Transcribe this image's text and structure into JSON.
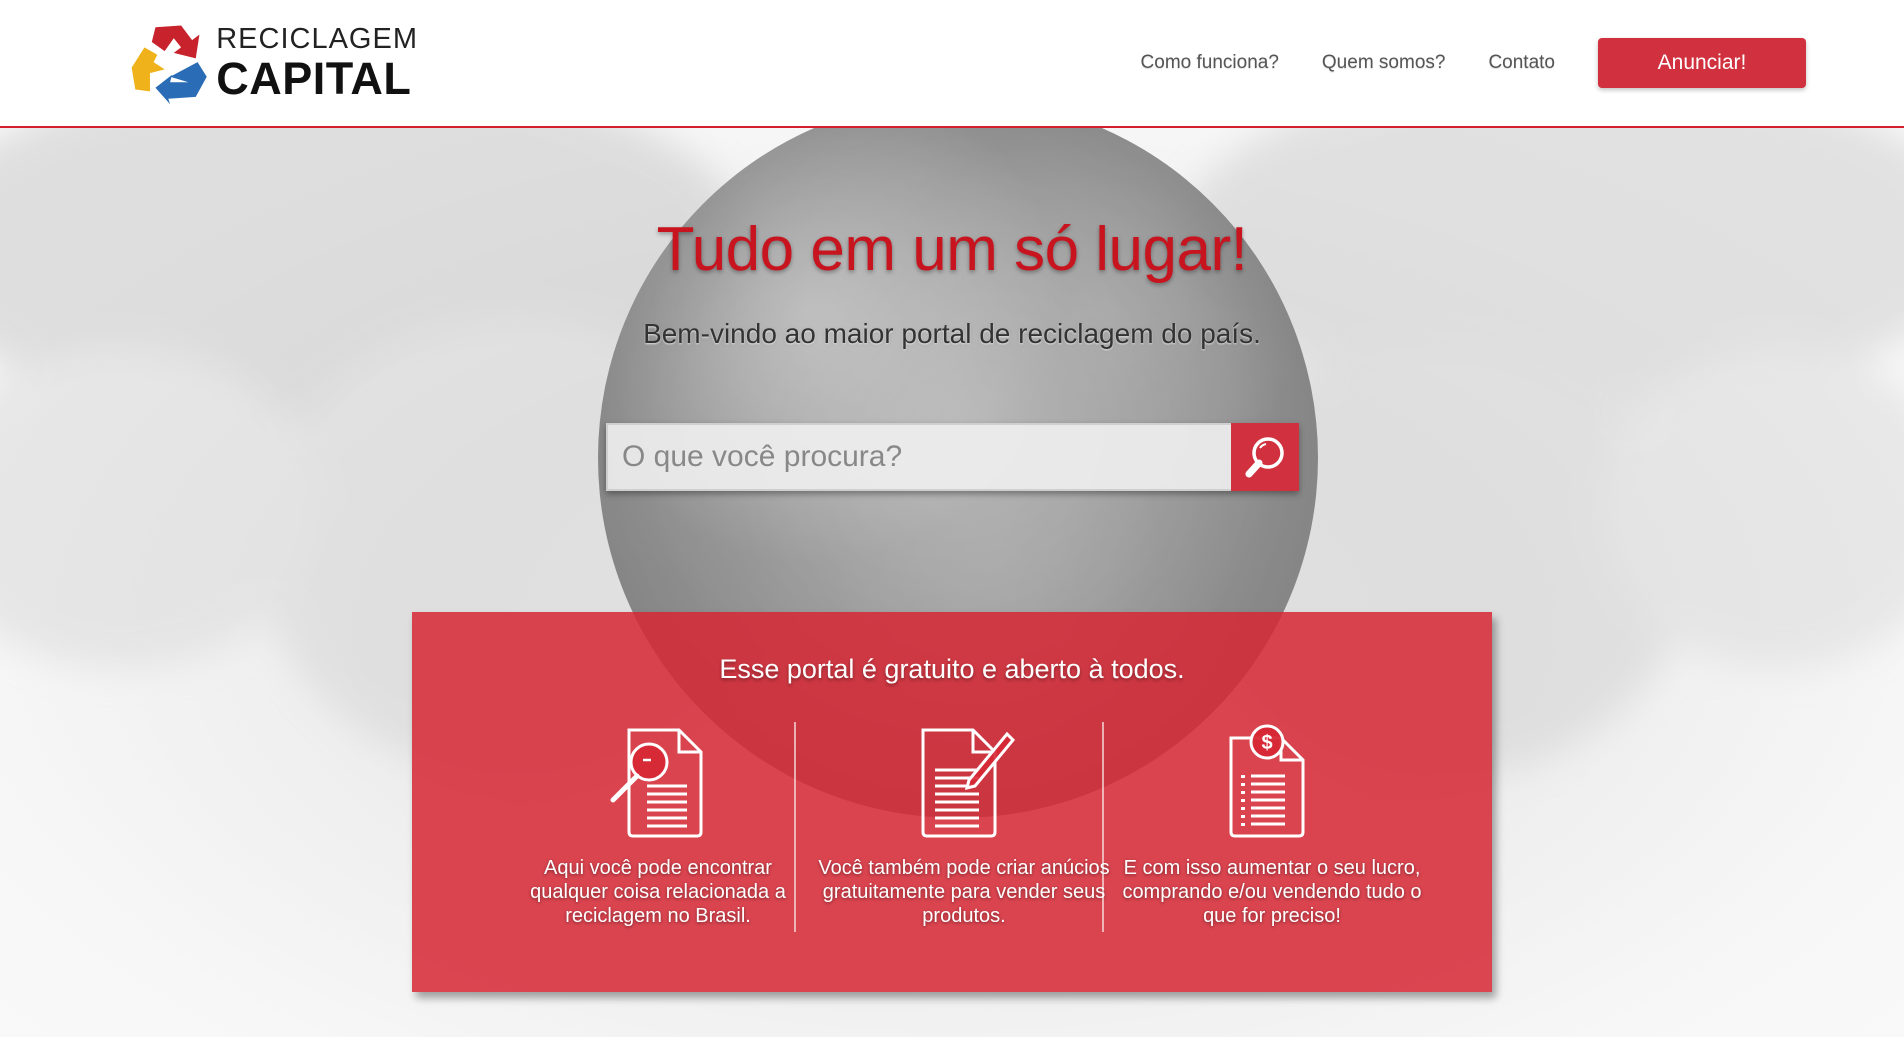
{
  "logo": {
    "line1": "RECICLAGEM",
    "line2": "CAPITAL"
  },
  "nav": {
    "items": [
      "Como funciona?",
      "Quem somos?",
      "Contato"
    ],
    "cta": "Anunciar!"
  },
  "hero": {
    "title": "Tudo em um só lugar!",
    "subtitle": "Bem-vindo ao maior portal de reciclagem do país.",
    "search_placeholder": "O que você procura?"
  },
  "info": {
    "title": "Esse portal é gratuito e aberto à todos.",
    "columns": [
      {
        "icon": "search-document-icon",
        "text": "Aqui você pode encontrar qualquer coisa relacionada a reciclagem no Brasil."
      },
      {
        "icon": "edit-document-icon",
        "text": "Você também pode criar anúcios gratuitamente para vender seus produtos."
      },
      {
        "icon": "money-document-icon",
        "text": "E com isso aumentar o seu lucro, comprando e/ou vendendo tudo o que for preciso!"
      }
    ]
  },
  "colors": {
    "brand_red": "#d1313f",
    "title_red": "#c8141f",
    "header_rule": "#d21f2b"
  }
}
